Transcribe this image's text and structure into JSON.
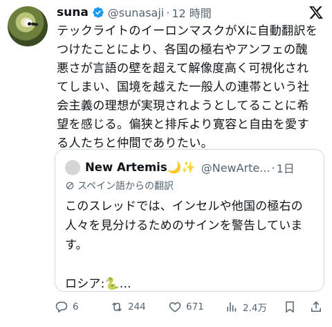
{
  "author": {
    "name": "suna",
    "handle": "@sunasaji",
    "separator": "·",
    "time": "12 時間"
  },
  "icons": {
    "verified": "verified-badge-icon",
    "platform": "x-logo-icon",
    "translate": "translate-icon",
    "reply": "reply-icon",
    "repost": "repost-icon",
    "like": "like-icon",
    "views": "views-icon",
    "bookmark": "bookmark-icon",
    "share": "share-icon"
  },
  "colors": {
    "verified": "#1d9bf0",
    "text": "#0f1419",
    "secondary": "#536471",
    "border": "#cfd9de"
  },
  "post": {
    "lines": [
      "テックライトのイーロンマスクがXに自動翻訳を",
      "つけたことにより、各国の極右やアンフェの醜",
      "悪さが言語の壁を超えて解像度高く可視化され",
      "てしまい、国境を越えた一般人の連帯という社",
      "会主義の理想が実現されようとしてることに希",
      "望を感じる。偏狭と排斥より寛容と自由を愛す",
      "る人たちと仲間でありたい。"
    ]
  },
  "quote": {
    "name": "New Artemis🌙✨",
    "handle": "@NewArte...",
    "separator": "·",
    "time": "1日",
    "translation_label": "スペイン語からの翻訳",
    "lines": [
      "このスレッドでは、インセルや他国の極右の",
      "人々を見分けるためのサインを警告していま",
      "す。",
      "",
      "ロシア:🐍..."
    ]
  },
  "actions": {
    "replies": "6",
    "reposts": "244",
    "likes": "671",
    "views": "2.4万"
  }
}
